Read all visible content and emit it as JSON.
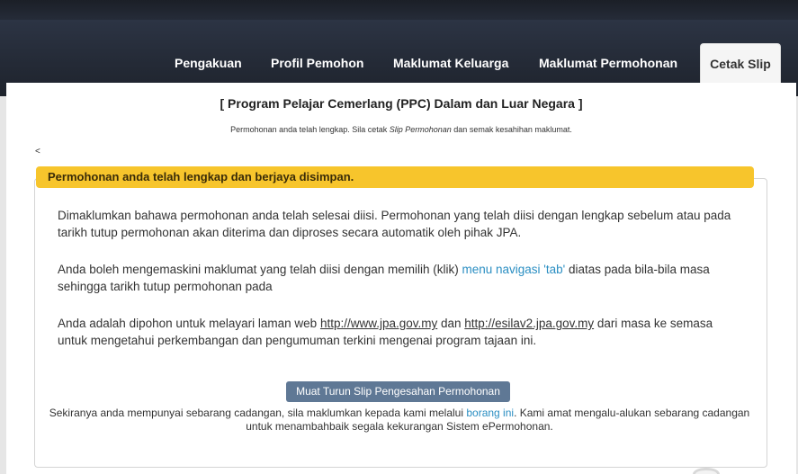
{
  "tabs": [
    {
      "label": "Pengakuan"
    },
    {
      "label": "Profil Pemohon"
    },
    {
      "label": "Maklumat Keluarga"
    },
    {
      "label": "Maklumat Permohonan"
    },
    {
      "label": "Cetak Slip"
    }
  ],
  "page": {
    "title": "[ Program Pelajar Cemerlang (PPC) Dalam dan Luar Negara ]",
    "info_before": "Permohonan anda telah lengkap. Sila cetak ",
    "info_italic": "Slip Permohonan",
    "info_after": " dan semak kesahihan maklumat.",
    "lt_char": "<"
  },
  "alert": {
    "text": "Permohonan anda telah lengkap dan berjaya disimpan."
  },
  "paragraphs": {
    "p1": "Dimaklumkan bahawa permohonan anda telah selesai diisi. Permohonan yang telah diisi dengan lengkap sebelum atau pada tarikh tutup permohonan akan diterima dan diproses secara automatik oleh pihak JPA.",
    "p2_before": "Anda boleh mengemaskini maklumat yang telah diisi dengan memilih (klik) ",
    "p2_link": "menu navigasi 'tab'",
    "p2_after": " diatas pada bila-bila masa sehingga tarikh tutup permohonan pada",
    "p3_before": "Anda adalah dipohon untuk melayari laman web ",
    "p3_link1": "http://www.jpa.gov.my",
    "p3_mid": " dan ",
    "p3_link2": "http://esilav2.jpa.gov.my",
    "p3_after": " dari masa ke semasa untuk mengetahui perkembangan dan pengumuman terkini mengenai program tajaan ini."
  },
  "download_button": "Muat Turun Slip Pengesahan Permohonan",
  "footer": {
    "before": "Sekiranya anda mempunyai sebarang cadangan, sila maklumkan kepada kami melalui ",
    "link": "borang ini",
    "after": ". Kami amat mengalu-alukan sebarang cadangan untuk menambahbaik segala kekurangan Sistem ePermohonan."
  },
  "colors": {
    "alert_bg": "#f7c52c",
    "link": "#2a8ec2",
    "button_bg": "#5f7895",
    "header_bg": "#1e232c"
  }
}
